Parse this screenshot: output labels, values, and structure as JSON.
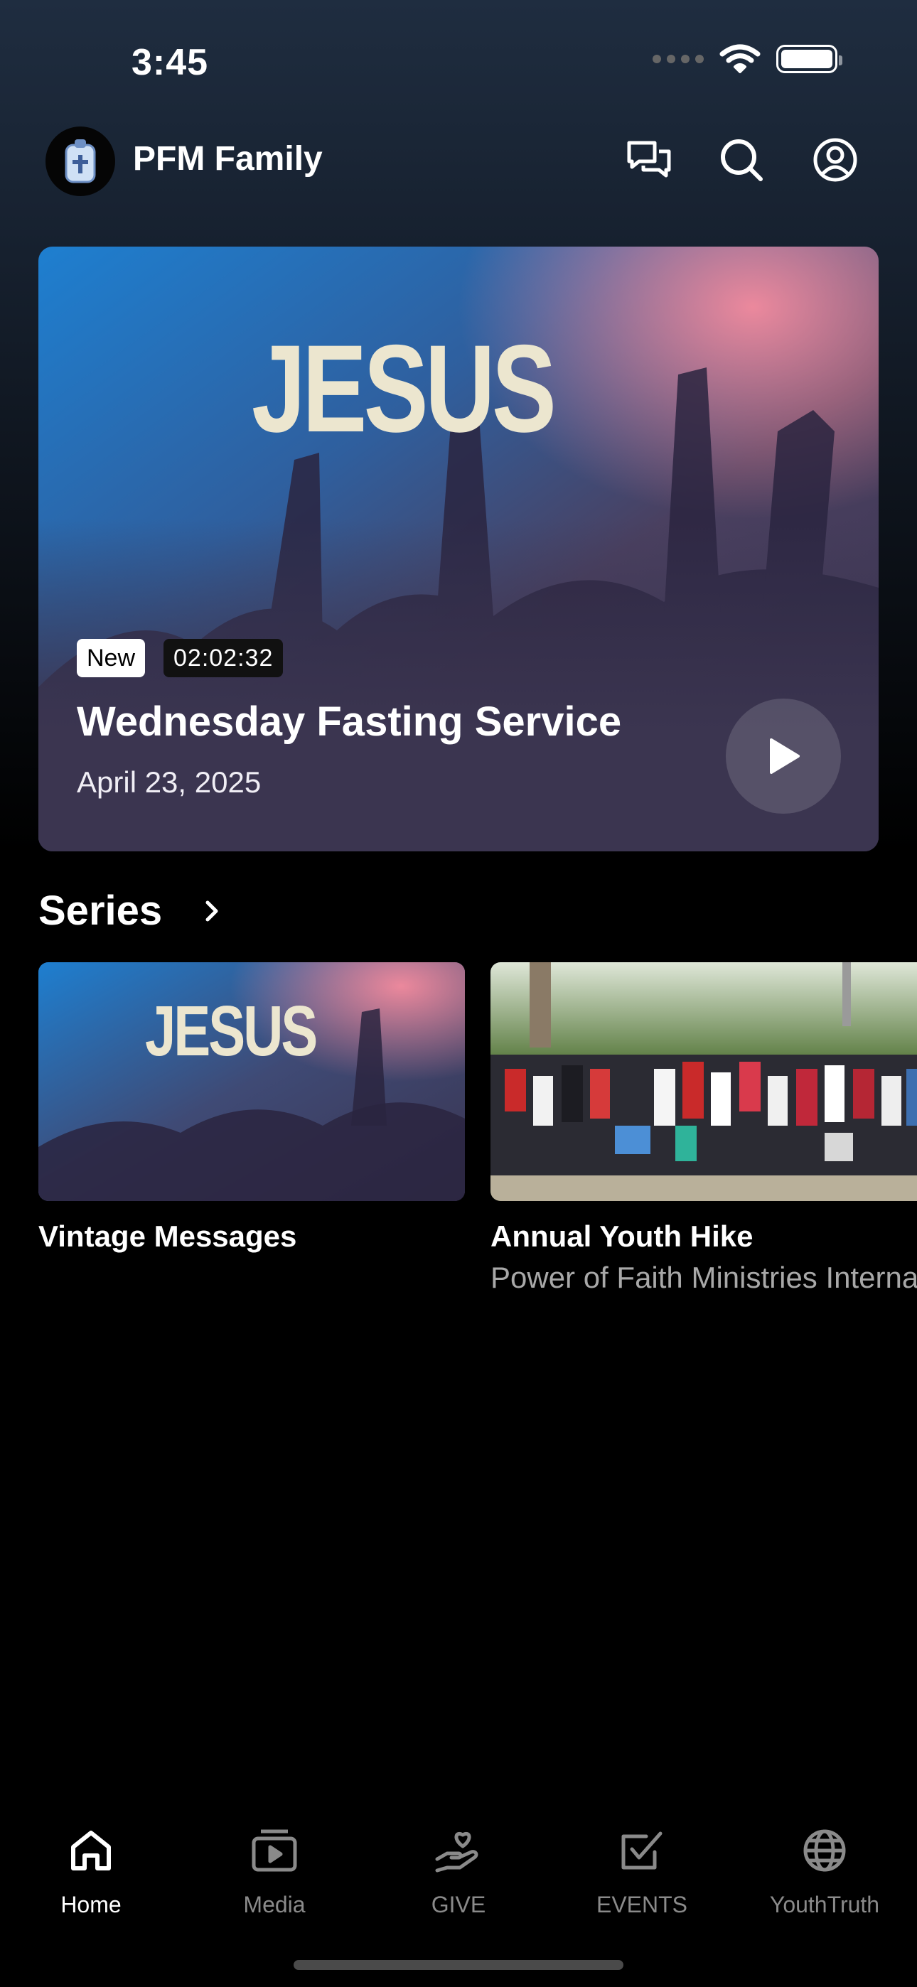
{
  "status_bar": {
    "time": "3:45"
  },
  "header": {
    "title": "PFM Family",
    "icons": [
      "chat-icon",
      "search-icon",
      "profile-icon"
    ]
  },
  "hero": {
    "art_text": "JESUS",
    "badge": "New",
    "duration": "02:02:32",
    "title": "Wednesday Fasting Service",
    "date": "April 23, 2025"
  },
  "series": {
    "heading": "Series",
    "cards": [
      {
        "title": "Vintage Messages",
        "subtitle": "",
        "art_text": "JESUS"
      },
      {
        "title": "Annual Youth Hike",
        "subtitle": "Power of Faith Ministries International"
      }
    ]
  },
  "tabs": [
    {
      "label": "Home",
      "icon": "home-icon",
      "active": true
    },
    {
      "label": "Media",
      "icon": "media-icon",
      "active": false
    },
    {
      "label": "GIVE",
      "icon": "give-icon",
      "active": false
    },
    {
      "label": "EVENTS",
      "icon": "events-icon",
      "active": false
    },
    {
      "label": "YouthTruth",
      "icon": "globe-icon",
      "active": false
    }
  ],
  "colors": {
    "background": "#000000",
    "card": "#3b3550",
    "muted_text": "#8a8a8a"
  }
}
